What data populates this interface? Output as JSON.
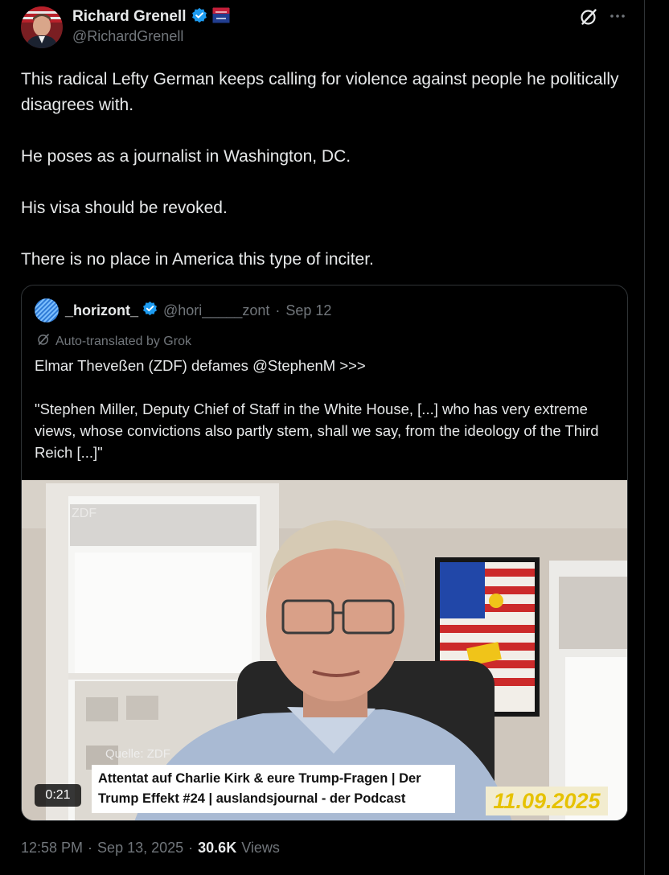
{
  "author": {
    "display_name": "Richard Grenell",
    "handle": "@RichardGrenell",
    "verified_color": "#1d9bf0"
  },
  "tweet": {
    "paragraphs": [
      "This radical Lefty German keeps calling for violence against people he politically disagrees with.",
      "He poses as a journalist in Washington, DC.",
      "His visa should be revoked.",
      "There is no place in America this type of inciter."
    ],
    "time": "12:58 PM",
    "date": "Sep 13, 2025",
    "views_count": "30.6K",
    "views_label": "Views"
  },
  "quote": {
    "display_name": "_horizont_",
    "handle": "@hori_____zont",
    "date": "Sep 12",
    "auto_translated": "Auto-translated by Grok",
    "paragraphs": [
      "Elmar Theveßen (ZDF) defames @StephenM >>>",
      "\"Stephen Miller, Deputy Chief of Staff in the White House, [...] who has very extreme views, whose convictions also partly stem, shall we say, from the ideology of the Third Reich [...]\""
    ],
    "video": {
      "source_label": "Quelle: ZDF",
      "caption": "Attentat auf Charlie Kirk & eure Trump-Fragen | Der Trump Effekt #24 | auslandsjournal - der Podcast",
      "date_badge": "11.09.2025",
      "duration": "0:21"
    }
  },
  "icons": {
    "grok": "grok-icon",
    "more": "more-icon",
    "verified": "verified-badge-icon",
    "affiliate": "affiliate-badge-icon"
  }
}
